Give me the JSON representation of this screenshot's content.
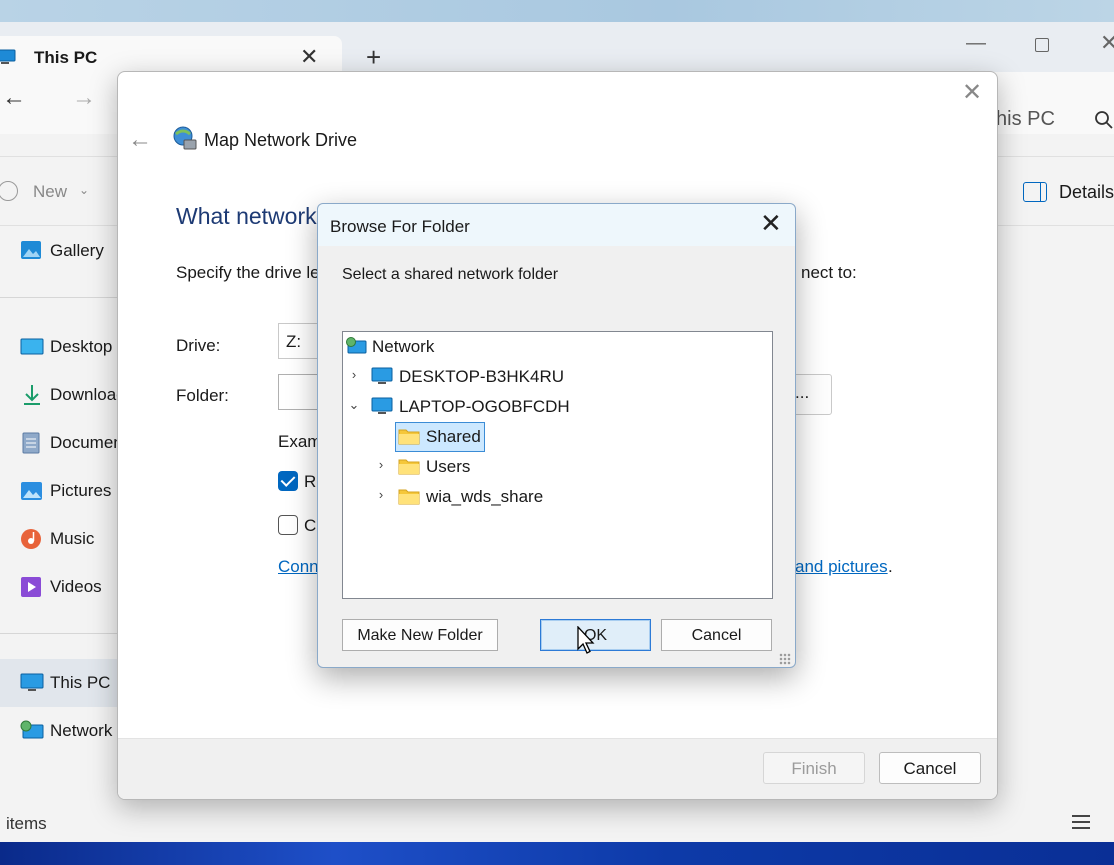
{
  "explorer": {
    "tab_title": "This PC",
    "tab_close": "✕",
    "tab_add": "+",
    "win_min": "—",
    "win_close": "✕",
    "nav_back": "←",
    "nav_forward": "→",
    "address": "his PC",
    "new_label": "New",
    "new_chevron": "⌄",
    "details_label": "Details",
    "sidebar": [
      {
        "label": "Gallery",
        "icon": "gallery-icon"
      },
      {
        "label": "Desktop",
        "icon": "desktop-icon"
      },
      {
        "label": "Downloads",
        "icon": "download-icon"
      },
      {
        "label": "Documents",
        "icon": "documents-icon"
      },
      {
        "label": "Pictures",
        "icon": "pictures-icon"
      },
      {
        "label": "Music",
        "icon": "music-icon"
      },
      {
        "label": "Videos",
        "icon": "videos-icon"
      },
      {
        "label": "This PC",
        "icon": "pc-icon"
      },
      {
        "label": "Network",
        "icon": "network-icon"
      }
    ],
    "status_text": "items"
  },
  "wizard": {
    "title": "Map Network Drive",
    "close": "✕",
    "back": "←",
    "heading": "What network",
    "description": "Specify the drive le",
    "description_tail": "nect to:",
    "drive_label": "Drive:",
    "drive_value": "Z:",
    "folder_label": "Folder:",
    "browse_label": "...",
    "example_label": "Exam",
    "reconnect_label": "Re",
    "credentials_label": "Co",
    "link_text": "Conn",
    "link_tail": "and pictures",
    "link_period": ".",
    "finish_label": "Finish",
    "cancel_label": "Cancel"
  },
  "browse_dialog": {
    "title": "Browse For Folder",
    "close": "✕",
    "prompt": "Select a shared network folder",
    "tree": {
      "root": "Network",
      "desktop": "DESKTOP-B3HK4RU",
      "laptop": "LAPTOP-OGOBFCDH",
      "shared": "Shared",
      "users": "Users",
      "wia": "wia_wds_share",
      "chev_collapsed": "›",
      "chev_expanded": "⌄"
    },
    "make_new_folder": "Make New Folder",
    "ok": "OK",
    "cancel": "Cancel"
  },
  "colors": {
    "accent": "#0067c0",
    "heading": "#1d3a74",
    "selection": "#cce8ff"
  }
}
